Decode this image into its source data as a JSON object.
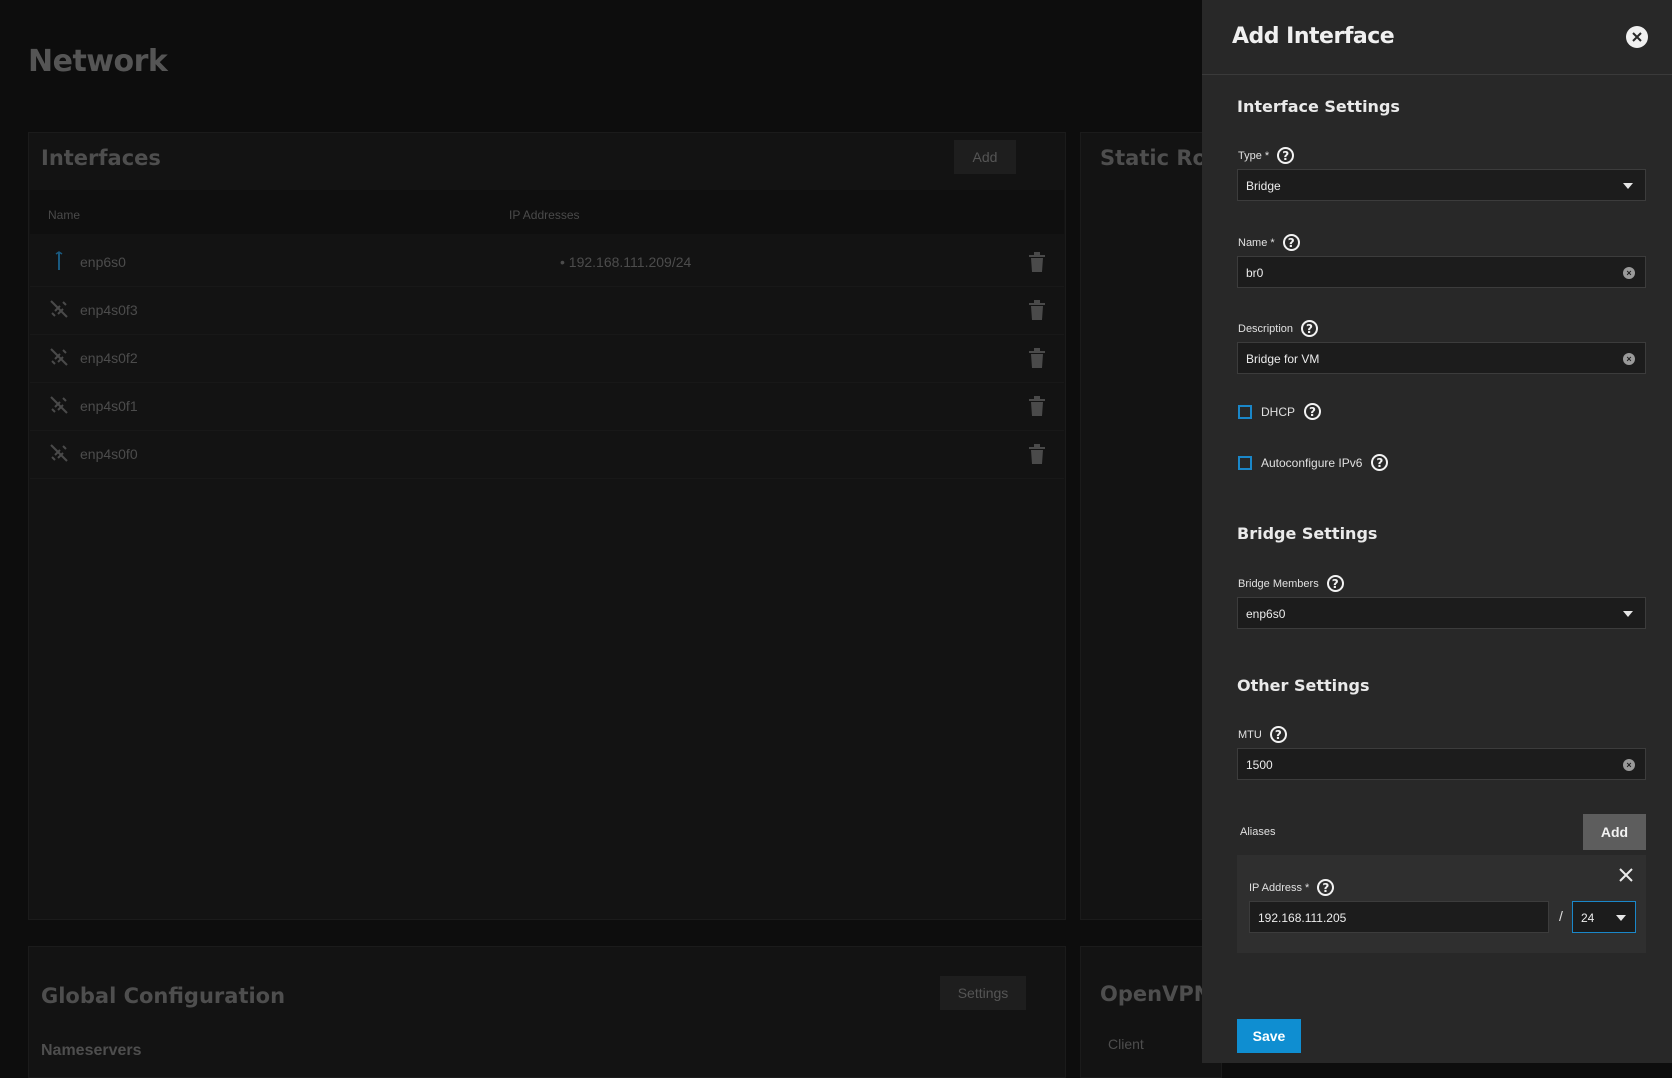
{
  "page": {
    "title": "Network"
  },
  "interfaces": {
    "title": "Interfaces",
    "add_label": "Add",
    "columns": [
      "Name",
      "IP Addresses"
    ],
    "rows": [
      {
        "name": "enp6s0",
        "ip": "192.168.111.209/24",
        "icon": "network-link-icon"
      },
      {
        "name": "enp4s0f3",
        "ip": "",
        "icon": "network-disconnected-icon"
      },
      {
        "name": "enp4s0f2",
        "ip": "",
        "icon": "network-disconnected-icon"
      },
      {
        "name": "enp4s0f1",
        "ip": "",
        "icon": "network-disconnected-icon"
      },
      {
        "name": "enp4s0f0",
        "ip": "",
        "icon": "network-disconnected-icon"
      }
    ]
  },
  "static_routes": {
    "title": "Static Rout"
  },
  "global_config": {
    "title": "Global Configuration",
    "settings_label": "Settings",
    "nameservers_label": "Nameservers"
  },
  "openvpn": {
    "title": "OpenVPN",
    "client_label": "Client"
  },
  "panel": {
    "title": "Add Interface",
    "interface_settings": "Interface Settings",
    "type": {
      "label": "Type *",
      "value": "Bridge"
    },
    "name": {
      "label": "Name *",
      "value": "br0"
    },
    "description": {
      "label": "Description",
      "value": "Bridge for VM"
    },
    "dhcp_label": "DHCP",
    "autoconfig_label": "Autoconfigure IPv6",
    "bridge_settings": "Bridge Settings",
    "bridge_members": {
      "label": "Bridge Members",
      "value": "enp6s0"
    },
    "other_settings": "Other Settings",
    "mtu": {
      "label": "MTU",
      "value": "1500"
    },
    "aliases_label": "Aliases",
    "aliases_add": "Add",
    "ip_address": {
      "label": "IP Address *",
      "value": "192.168.111.205",
      "separator": "/",
      "netmask": "24"
    },
    "save_label": "Save"
  },
  "colors": {
    "accent": "#0f8ed1",
    "panel_bg": "#282828",
    "checkbox": "#1a87c9"
  }
}
